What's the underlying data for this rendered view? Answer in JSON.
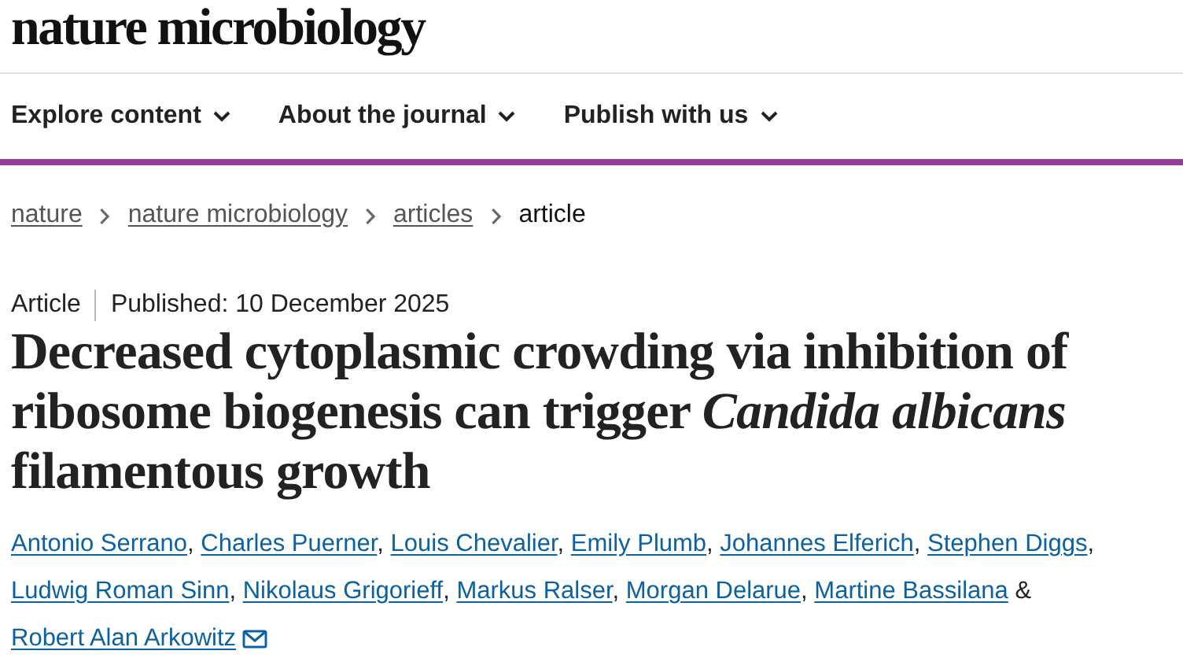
{
  "site": {
    "logo": "nature microbiology"
  },
  "nav": [
    {
      "label": "Explore content"
    },
    {
      "label": "About the journal"
    },
    {
      "label": "Publish with us"
    }
  ],
  "breadcrumb": [
    {
      "label": "nature",
      "link": true
    },
    {
      "label": "nature microbiology",
      "link": true
    },
    {
      "label": "articles",
      "link": true
    },
    {
      "label": "article",
      "link": false
    }
  ],
  "article": {
    "type": "Article",
    "published": "Published: 10 December 2025",
    "title": "Decreased cytoplasmic crowding via inhibition of ribosome biogenesis can trigger *Candida albicans* filamentous growth",
    "authors": [
      {
        "name": "Antonio Serrano",
        "separator": ","
      },
      {
        "name": "Charles Puerner",
        "separator": ","
      },
      {
        "name": "Louis Chevalier",
        "separator": ","
      },
      {
        "name": "Emily Plumb",
        "separator": ","
      },
      {
        "name": "Johannes Elferich",
        "separator": ","
      },
      {
        "name": "Stephen Diggs",
        "separator": ","
      },
      {
        "name": "Ludwig Roman Sinn",
        "separator": ","
      },
      {
        "name": "Nikolaus Grigorieff",
        "separator": ","
      },
      {
        "name": "Markus Ralser",
        "separator": ","
      },
      {
        "name": "Morgan Delarue",
        "separator": ","
      },
      {
        "name": "Martine Bassilana",
        "separator": "&"
      },
      {
        "name": "Robert Alan Arkowitz",
        "email": true
      }
    ]
  }
}
